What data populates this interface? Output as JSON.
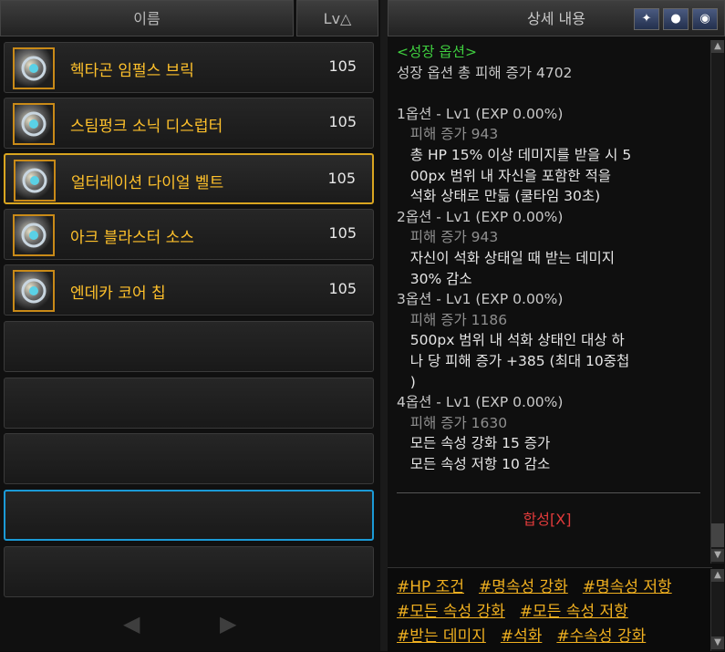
{
  "list": {
    "header_name": "이름",
    "header_lv": "Lv△",
    "items": [
      {
        "name": "헥타곤 임펄스 브릭",
        "lv": "105",
        "icon": "armor-gauntlet-icon"
      },
      {
        "name": "스팀펑크 소닉 디스럽터",
        "lv": "105",
        "icon": "gear-weapon-icon"
      },
      {
        "name": "얼터레이션 다이얼 벨트",
        "lv": "105",
        "icon": "belt-icon"
      },
      {
        "name": "아크 블라스터 소스",
        "lv": "105",
        "icon": "ring-icon"
      },
      {
        "name": "엔데카 코어 칩",
        "lv": "105",
        "icon": "chip-icon"
      }
    ],
    "pager": {
      "prev": "◀",
      "next": "▶"
    }
  },
  "detail": {
    "header": "상세 내용",
    "icons": [
      "wing-icon",
      "pin-icon",
      "eye-icon"
    ],
    "lines": [
      {
        "text": "<성장 옵션>",
        "color": "#3fcf3f"
      },
      {
        "text": "성장 옵션 총 피해 증가 4702",
        "color": "#c9c9c9"
      },
      {
        "text": " ",
        "color": "#c9c9c9"
      },
      {
        "text": "1옵션 - Lv1 (EXP 0.00%)",
        "color": "#c9c9c9"
      },
      {
        "text": "   피해 증가 943",
        "color": "#8f8f8f"
      },
      {
        "text": "   총 HP 15% 이상 데미지를 받을 시 5",
        "color": "#e6e6e6"
      },
      {
        "text": "   00px 범위 내 자신을 포함한 적을",
        "color": "#e6e6e6"
      },
      {
        "text": "   석화 상태로 만듦 (쿨타임 30초)",
        "color": "#e6e6e6"
      },
      {
        "text": "2옵션 - Lv1 (EXP 0.00%)",
        "color": "#c9c9c9"
      },
      {
        "text": "   피해 증가 943",
        "color": "#8f8f8f"
      },
      {
        "text": "   자신이 석화 상태일 때 받는 데미지",
        "color": "#e6e6e6"
      },
      {
        "text": "   30% 감소",
        "color": "#e6e6e6"
      },
      {
        "text": "3옵션 - Lv1 (EXP 0.00%)",
        "color": "#c9c9c9"
      },
      {
        "text": "   피해 증가 1186",
        "color": "#8f8f8f"
      },
      {
        "text": "   500px 범위 내 석화 상태인 대상 하",
        "color": "#e6e6e6"
      },
      {
        "text": "   나 당 피해 증가 +385 (최대 10중첩",
        "color": "#e6e6e6"
      },
      {
        "text": "   )",
        "color": "#e6e6e6"
      },
      {
        "text": "4옵션 - Lv1 (EXP 0.00%)",
        "color": "#c9c9c9"
      },
      {
        "text": "   피해 증가 1630",
        "color": "#8f8f8f"
      },
      {
        "text": "   모든 속성 강화 15 증가",
        "color": "#e6e6e6"
      },
      {
        "text": "   모든 속성 저항 10 감소",
        "color": "#e6e6e6"
      }
    ],
    "synth": "합성[X]",
    "tags": [
      [
        "#HP 조건",
        "#명속성 강화",
        "#명속성 저항"
      ],
      [
        "#모든 속성 강화",
        "#모든 속성 저항"
      ],
      [
        "#받는 데미지",
        "#석화",
        "#수속성 강화"
      ]
    ]
  }
}
